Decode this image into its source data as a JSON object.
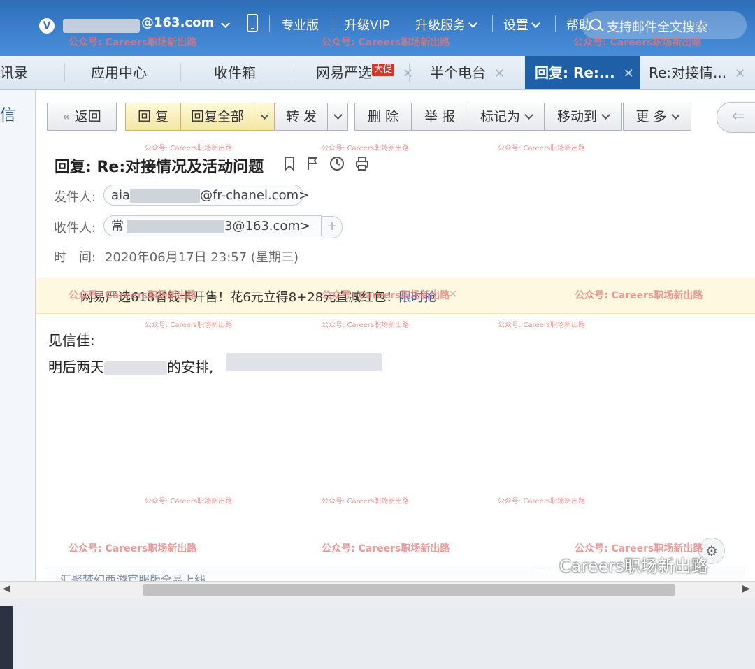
{
  "topbar": {
    "account_suffix": "@163.com",
    "menu": [
      "专业版",
      "升级VIP",
      "升级服务",
      "设置",
      "帮助"
    ],
    "search_placeholder": "支持邮件全文搜索"
  },
  "tabs": [
    {
      "label": "讯录"
    },
    {
      "label": "应用中心"
    },
    {
      "label": "收件箱"
    },
    {
      "label": "网易严选",
      "badge": "大促"
    },
    {
      "label": "半个电台"
    },
    {
      "label": "回复: Re:..."
    },
    {
      "label": "Re:对接情..."
    }
  ],
  "left_nav": {
    "label": "信"
  },
  "toolbar": {
    "back": "返回",
    "reply": "回 复",
    "reply_all": "回复全部",
    "forward": "转 发",
    "delete": "删 除",
    "report": "举 报",
    "mark_as": "标记为",
    "move_to": "移动到",
    "more": "更 多"
  },
  "email": {
    "subject": "回复: Re:对接情况及活动问题",
    "from_label": "发件人:",
    "from_prefix": "aia",
    "from_suffix": "@fr-chanel.com>",
    "to_label": "收件人:",
    "to_prefix": "常",
    "to_suffix": "3@163.com>",
    "time_label": "时　间:",
    "time_value": "2020年06月17日 23:57 (星期三)",
    "promo_text": "网易严选618省钱卡开售！花6元立得8+28元直减红包！",
    "promo_link": "限时抢",
    "greeting": "见信佳:",
    "line1_a": "明后两天",
    "line1_b": "的安排,",
    "footer_text": "汇聚梦幻西游官服版全品上线"
  },
  "watermark": {
    "large": "公众号: Careers职场新出路",
    "small": "公众号: Careers职场新出路",
    "brand": "Careers职场新出路"
  }
}
